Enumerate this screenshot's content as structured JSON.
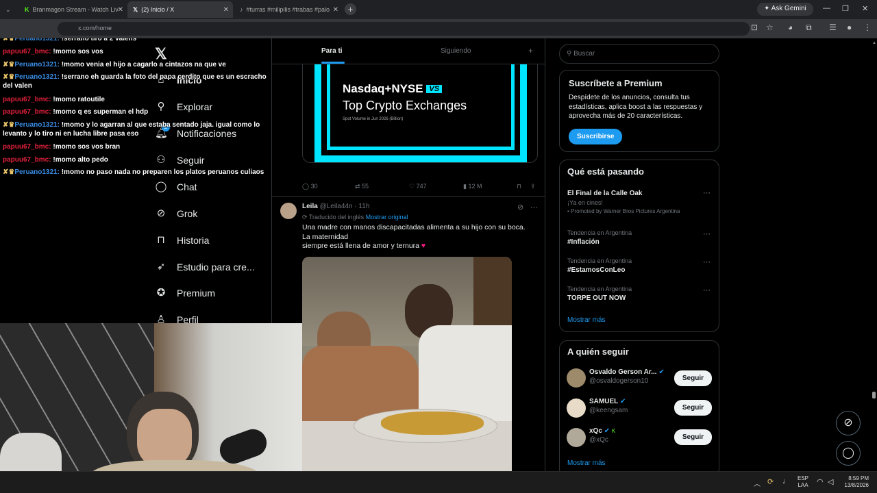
{
  "browser": {
    "tabs": [
      {
        "label": "Branmagon Stream - Watch Liv"
      },
      {
        "label": "(2) Inicio / X"
      },
      {
        "label": "#turras #milipilis #trabas #palo"
      }
    ],
    "ask_gemini": "Ask Gemini",
    "url_text": "x.com/home"
  },
  "chat": [
    {
      "user": "Peruano1321:",
      "msg": "!serrano tiro a 2 valens",
      "user_color": "#3a8ee6"
    },
    {
      "user": "papuu67_bmc:",
      "msg": "!momo sos vos",
      "user_color": "#e0213b"
    },
    {
      "user": "Peruano1321:",
      "msg": "!momo venia el hijo a cagarlo a cintazos na que ve",
      "user_color": "#3a8ee6"
    },
    {
      "user": "Peruano1321:",
      "msg": "!serrano eh guarda la foto del papa cerdito que es un escracho del valen",
      "user_color": "#3a8ee6"
    },
    {
      "user": "papuu67_bmc:",
      "msg": "!momo ratoutile",
      "user_color": "#e0213b"
    },
    {
      "user": "papuu67_bmc:",
      "msg": "!momo q es superman el hdp",
      "user_color": "#e0213b"
    },
    {
      "user": "Peruano1321:",
      "msg": "!momo y lo agarran al que estaba sentado jaja. igual como lo levanto y lo tiro ni en lucha libre pasa eso",
      "user_color": "#3a8ee6"
    },
    {
      "user": "papuu67_bmc:",
      "msg": "!momo sos vos bran",
      "user_color": "#e0213b"
    },
    {
      "user": "papuu67_bmc:",
      "msg": "!momo alto pedo",
      "user_color": "#e0213b"
    },
    {
      "user": "Peruano1321:",
      "msg": "!momo no paso nada no preparen los platos peruanos culiaos",
      "user_color": "#3a8ee6"
    }
  ],
  "nav": {
    "items": [
      {
        "label": "Inicio",
        "icon": "home-icon"
      },
      {
        "label": "Explorar",
        "icon": "search-icon"
      },
      {
        "label": "Notificaciones",
        "icon": "bell-icon",
        "badge": "2"
      },
      {
        "label": "Seguir",
        "icon": "add-person-icon"
      },
      {
        "label": "Chat",
        "icon": "chat-icon"
      },
      {
        "label": "Grok",
        "icon": "grok-icon"
      },
      {
        "label": "Historia",
        "icon": "bookmark-icon"
      },
      {
        "label": "Estudio para cre...",
        "icon": "rocket-icon"
      },
      {
        "label": "Premium",
        "icon": "verified-icon"
      },
      {
        "label": "Perfil",
        "icon": "person-icon"
      }
    ]
  },
  "feed": {
    "tab_for_you": "Para ti",
    "tab_following": "Siguiendo",
    "promo": {
      "headline": "Nasdaq+NYSE",
      "vs": "VS",
      "subline": "Top Crypto Exchanges",
      "caption": "Spot Volume in Jun 2026 (Billion)"
    },
    "promo_actions": {
      "replies": "30",
      "reposts": "55",
      "likes": "747",
      "views": "12 M"
    },
    "tweet": {
      "name": "Leila",
      "handle": "@Leila44n",
      "time": "· 11h",
      "translated": "Traducido del inglés",
      "show_original": "Mostrar original",
      "text_line1": "Una madre con manos discapacitadas alimenta a su hijo con su boca. La maternidad",
      "text_line2": "siempre está llena de amor y ternura"
    }
  },
  "right": {
    "search_placeholder": "Buscar",
    "premium_title": "Suscríbete a Premium",
    "premium_text": "Despídete de los anuncios, consulta tus estadísticas, aplica boost a las respuestas y aprovecha más de 20 características.",
    "premium_button": "Suscribirse",
    "trends_title": "Qué está pasando",
    "trends": [
      {
        "title": "El Final de la Calle Oak",
        "sub": "¡Ya en cines!",
        "promo": "Promoted by Warner Bros Pictures Argentina"
      },
      {
        "context": "Tendencia en Argentina",
        "title": "#Inflación"
      },
      {
        "context": "Tendencia en Argentina",
        "title": "#EstamosConLeo"
      },
      {
        "context": "Tendencia en Argentina",
        "title": "TORPE OUT NOW"
      }
    ],
    "show_more": "Mostrar más",
    "follow_title": "A quién seguir",
    "follow": [
      {
        "name": "Osvaldo Gerson Ar...",
        "handle": "@osvaldogerson10"
      },
      {
        "name": "SAMUEL",
        "handle": "@keengsam"
      },
      {
        "name": "xQc",
        "handle": "@xQc"
      }
    ],
    "follow_button": "Seguir",
    "follow_more": "Mostrar más"
  },
  "taskbar": {
    "lang1": "ESP",
    "lang2": "LAA",
    "time": "8:59 PM",
    "date": "13/8/2026"
  },
  "colors": {
    "accent": "#1d9bf0",
    "promo_cyan": "#00e5ff",
    "heart": "#f91880"
  }
}
